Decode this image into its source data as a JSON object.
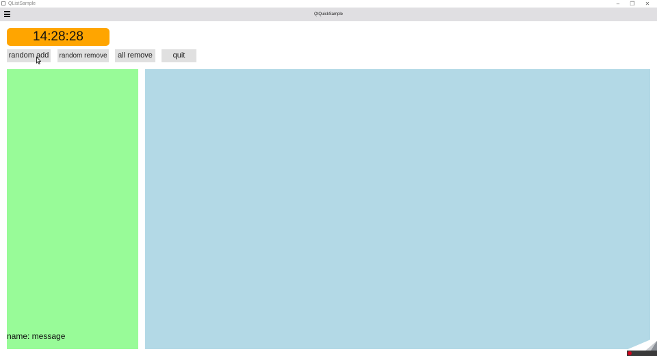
{
  "window": {
    "title": "QListSample",
    "controls": {
      "minimize": "–",
      "maximize": "❐",
      "close": "✕"
    }
  },
  "appbar": {
    "title": "QtQuickSample"
  },
  "clock": {
    "time": "14:28:28"
  },
  "buttons": {
    "random_add": "random add",
    "random_remove": "random remove",
    "all_remove": "all remove",
    "quit": "quit"
  },
  "left_panel": {
    "message": "name: message"
  },
  "colors": {
    "clock_bg": "#ffa500",
    "left_panel_bg": "#98fb98",
    "right_panel_bg": "#b3d9e6",
    "appbar_bg": "#e0dfe2",
    "button_bg": "#e0e0e0"
  }
}
